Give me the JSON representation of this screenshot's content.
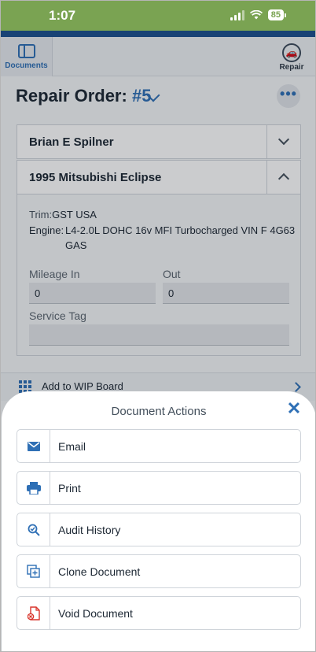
{
  "status_bar": {
    "time": "1:07",
    "battery": "85"
  },
  "nav": {
    "documents_label": "Documents",
    "repair_label": "Repair"
  },
  "repair_order": {
    "title": "Repair Order:",
    "number": "#5",
    "more": "•••"
  },
  "customer": {
    "name": "Brian E Spilner"
  },
  "vehicle": {
    "name": "1995 Mitsubishi Eclipse",
    "trim_label": "Trim:",
    "trim": "GST USA",
    "engine_label": "Engine:",
    "engine_line1": "L4-2.0L DOHC 16v MFI Turbocharged VIN F 4G63",
    "engine_line2": "GAS",
    "mileage_in_label": "Mileage In",
    "mileage_in": "0",
    "out_label": "Out",
    "mileage_out": "0",
    "service_tag_label": "Service Tag",
    "service_tag": ""
  },
  "wip": {
    "label": "Add to WIP Board"
  },
  "sheet": {
    "title": "Document Actions",
    "close": "✕",
    "actions": [
      {
        "label": "Email",
        "icon": "envelope-icon",
        "color": "#2e6fb5"
      },
      {
        "label": "Print",
        "icon": "printer-icon",
        "color": "#2e6fb5"
      },
      {
        "label": "Audit History",
        "icon": "audit-search-icon",
        "color": "#2e6fb5"
      },
      {
        "label": "Clone Document",
        "icon": "clone-icon",
        "color": "#2e6fb5"
      },
      {
        "label": "Void Document",
        "icon": "void-document-icon",
        "color": "#d9342b"
      }
    ]
  }
}
